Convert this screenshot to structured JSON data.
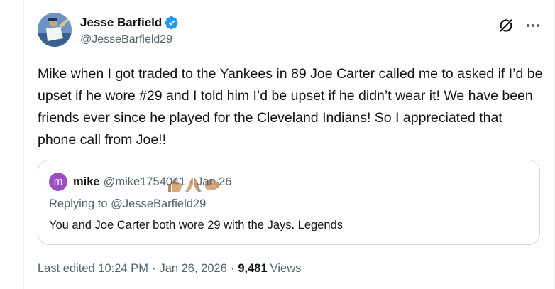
{
  "author": {
    "display_name": "Jesse Barfield",
    "handle": "@JesseBarfield29",
    "verified": true
  },
  "tweet": {
    "text": "Mike when I got traded to the Yankees in 89 Joe Carter called me to asked if I’d be upset if he wore #29 and I told him I’d be upset if he didn’t wear it! We have been friends ever since he played for the Cleveland Indians! So I appreciated that phone call from Joe!!",
    "emojis": [
      "thumbs-up-medium-skin",
      "folded-hands-medium-skin",
      "fist-bump-medium-skin"
    ]
  },
  "quoted": {
    "avatar_letter": "m",
    "avatar_color": "#9b4fc4",
    "display_name": "mike",
    "handle": "@mike1754041",
    "separator": "·",
    "date": "Jan 26",
    "replying_to": "Replying to @JesseBarfield29",
    "text": "You and Joe Carter both wore 29 with the Jays. Legends"
  },
  "meta": {
    "edited_label": "Last edited 10:24 PM",
    "separator": "·",
    "date": "Jan 26, 2026",
    "views_count": "9,481",
    "views_label": "Views"
  },
  "colors": {
    "text_primary": "#0f1419",
    "text_secondary": "#536471",
    "border": "#cfd9de",
    "verified_blue": "#1d9bf0"
  },
  "icons": {
    "grok": "grok-icon",
    "more": "more-icon",
    "verified": "verified-badge-icon"
  }
}
